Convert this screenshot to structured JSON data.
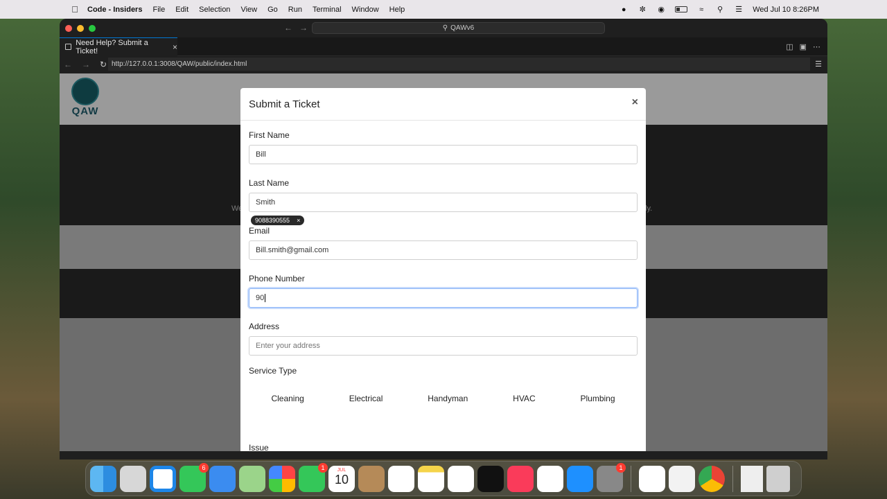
{
  "menubar": {
    "app_name": "Code - Insiders",
    "menus": [
      "File",
      "Edit",
      "Selection",
      "View",
      "Go",
      "Run",
      "Terminal",
      "Window",
      "Help"
    ],
    "datetime": "Wed Jul 10  8:26PM"
  },
  "window": {
    "command_center": "QAWv6",
    "tab": {
      "title": "Need Help? Submit a Ticket!"
    },
    "url": "http://127.0.0.1:3008/QAW/public/index.html"
  },
  "page": {
    "logo_text": "QAW",
    "bg_text_left": "We",
    "bg_text_right": "ly."
  },
  "modal": {
    "title": "Submit a Ticket",
    "close": "×",
    "fields": {
      "first_name": {
        "label": "First Name",
        "value": "Bill"
      },
      "last_name": {
        "label": "Last Name",
        "value": "Smith"
      },
      "email": {
        "label": "Email",
        "value": "Bill.smith@gmail.com"
      },
      "phone": {
        "label": "Phone Number",
        "value": "90"
      },
      "address": {
        "label": "Address",
        "placeholder": "Enter your address"
      }
    },
    "autofill_suggestion": {
      "value": "9088390555",
      "dismiss": "×"
    },
    "service_type": {
      "label": "Service Type",
      "options": [
        "Cleaning",
        "Electrical",
        "Handyman",
        "HVAC",
        "Plumbing"
      ]
    },
    "issue_label": "Issue"
  },
  "dock": {
    "badges": {
      "messages": "6",
      "facetime": "1",
      "settings": "1"
    },
    "calendar": {
      "month": "JUL",
      "day": "10"
    }
  }
}
